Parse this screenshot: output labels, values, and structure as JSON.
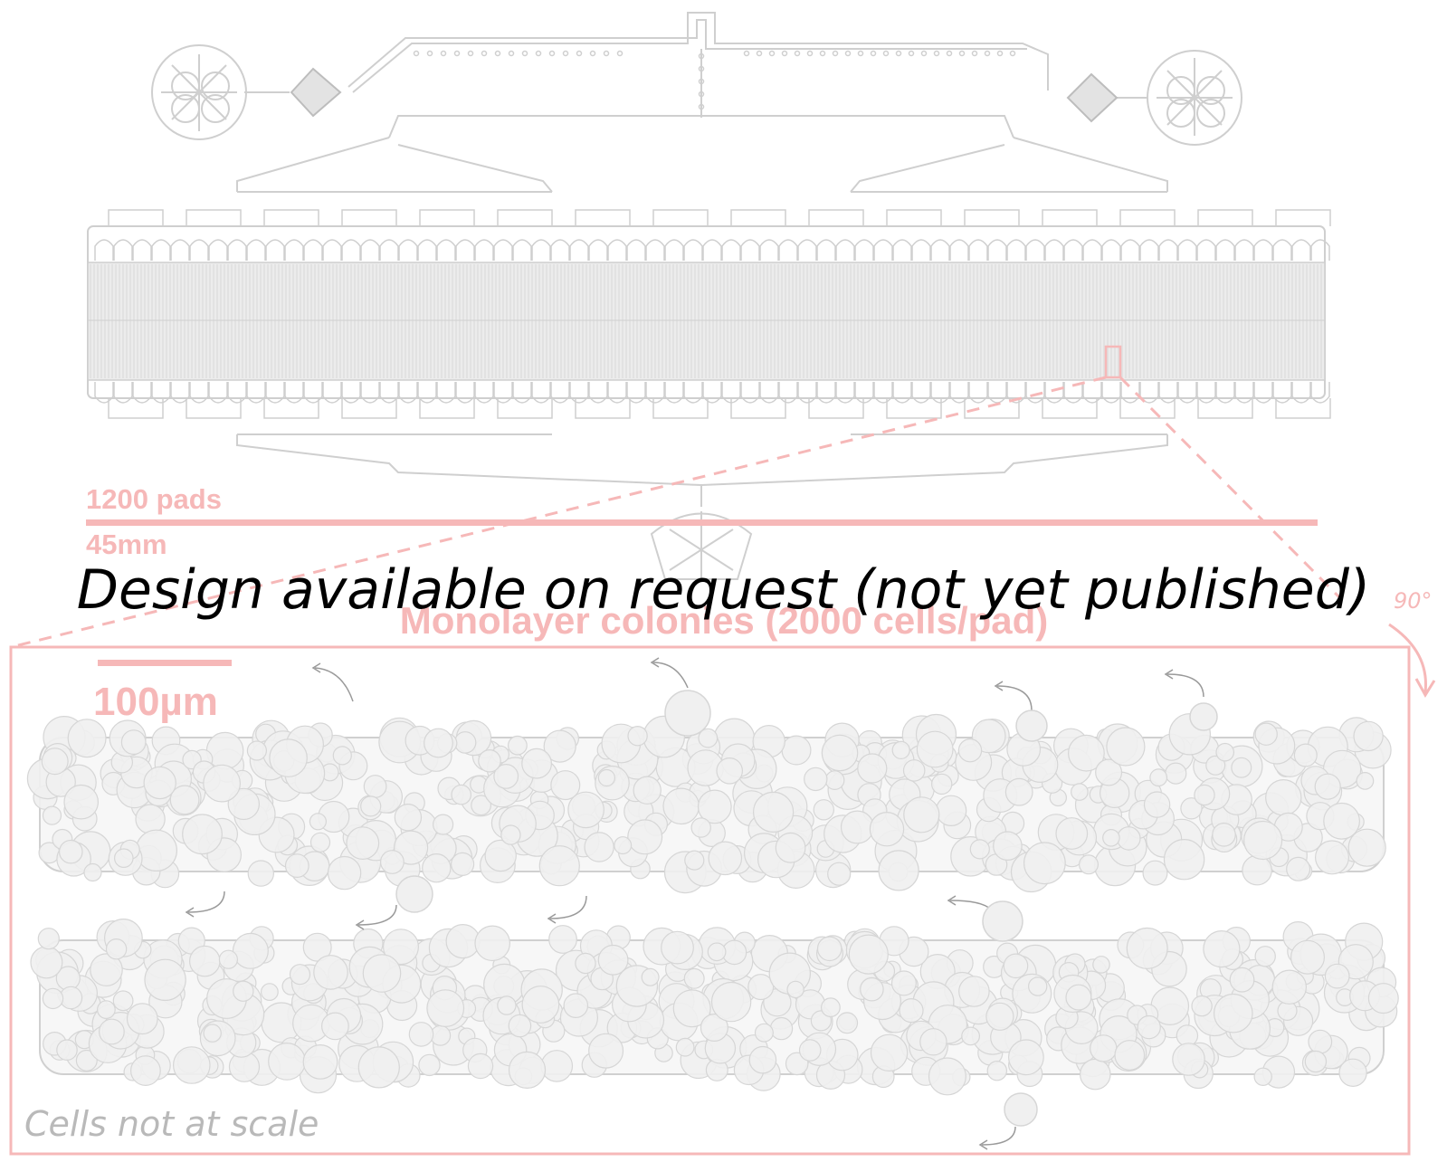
{
  "colors": {
    "accent_pink": "#f6b8b8",
    "device_outline": "#cfcfcf",
    "cell_fill": "#f0f0f0",
    "cell_stroke": "#d6d6d6",
    "overlay_text": "#000000"
  },
  "device": {
    "pads_label": "1200 pads",
    "length_label": "45mm",
    "icons": [
      "inlet-flower-icon",
      "filter-diamond-icon",
      "outlet-flower-icon"
    ]
  },
  "zoom": {
    "title": "Monolayer colonies (2000 cells/pad)",
    "scale_bar_label": "100µm",
    "rotation_label": "90°",
    "note": "Cells not at scale"
  },
  "watermark": {
    "text": "Design available on request (not yet published)"
  }
}
